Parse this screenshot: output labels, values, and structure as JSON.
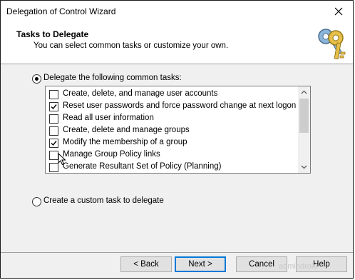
{
  "window": {
    "title": "Delegation of Control Wizard"
  },
  "header": {
    "title": "Tasks to Delegate",
    "subtitle": "You can select common tasks or customize your own.",
    "icon": "keys-icon"
  },
  "options": {
    "common_tasks_label": "Delegate the following common tasks:",
    "common_tasks_selected": true,
    "custom_task_label": "Create a custom task to delegate",
    "custom_task_selected": false
  },
  "tasks": [
    {
      "label": "Create, delete, and manage user accounts",
      "checked": false
    },
    {
      "label": "Reset user passwords and force password change at next logon",
      "checked": true
    },
    {
      "label": "Read all user information",
      "checked": false
    },
    {
      "label": "Create, delete and manage groups",
      "checked": false
    },
    {
      "label": "Modify the membership of a group",
      "checked": true
    },
    {
      "label": "Manage Group Policy links",
      "checked": false
    },
    {
      "label": "Generate Resultant Set of Policy (Planning)",
      "checked": false
    }
  ],
  "buttons": {
    "back": "< Back",
    "next": "Next >",
    "cancel": "Cancel",
    "help": "Help"
  },
  "watermark": "admindroid"
}
